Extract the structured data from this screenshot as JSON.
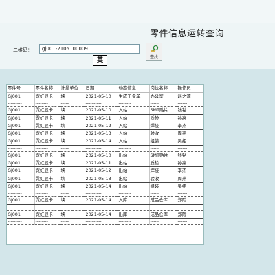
{
  "title": "零件信息运转查询",
  "qr_label": "二维码：",
  "qr_input": "gj001-2105100009",
  "ime_indicator": "英",
  "find_button": {
    "label": "查找",
    "icon": "search-icon"
  },
  "columns": [
    "零件号",
    "零件名称",
    "计量单位",
    "日期",
    "动态信息",
    "岗位名称",
    "操作员"
  ],
  "rows": [
    {
      "type": "data",
      "cells": [
        "Gj001",
        "霓虹显卡",
        "块",
        "2021-05-10",
        "生成工令单",
        "办公室",
        "赵之源"
      ]
    },
    {
      "type": "sep",
      "cells": [
        "---------",
        "--------",
        "-----",
        "----------",
        "--------",
        "------",
        "------"
      ]
    },
    {
      "type": "data",
      "cells": [
        "Gj001",
        "霓虹显卡",
        "块",
        "2021-05-10",
        "入站",
        "SMT贴片",
        "钱钻"
      ]
    },
    {
      "type": "data",
      "cells": [
        "Gj001",
        "霓虹显卡",
        "块",
        "2021-05-11",
        "入站",
        "质检",
        "孙高"
      ]
    },
    {
      "type": "data",
      "cells": [
        "Gj001",
        "霓虹显卡",
        "块",
        "2021-05-12",
        "入站",
        "焊接",
        "李杰"
      ]
    },
    {
      "type": "data",
      "cells": [
        "Gj001",
        "霓虹显卡",
        "块",
        "2021-05-13",
        "入站",
        "验收",
        "周燕"
      ]
    },
    {
      "type": "data",
      "cells": [
        "Gj001",
        "霓虹显卡",
        "块",
        "2021-05-14",
        "入站",
        "组装",
        "吴组"
      ]
    },
    {
      "type": "sep",
      "cells": [
        "---------",
        "--------",
        "-----",
        "----------",
        "--------",
        "------",
        "------"
      ]
    },
    {
      "type": "data",
      "cells": [
        "Gj001",
        "霓虹显卡",
        "块",
        "2021-05-10",
        "出站",
        "SMT贴片",
        "钱钻"
      ]
    },
    {
      "type": "data",
      "cells": [
        "Gj001",
        "霓虹显卡",
        "块",
        "2021-05-11",
        "出站",
        "质检",
        "孙高"
      ]
    },
    {
      "type": "data",
      "cells": [
        "Gj001",
        "霓虹显卡",
        "块",
        "2021-05-12",
        "出站",
        "焊接",
        "李杰"
      ]
    },
    {
      "type": "data",
      "cells": [
        "Gj001",
        "霓虹显卡",
        "块",
        "2021-05-13",
        "出站",
        "验收",
        "周燕"
      ]
    },
    {
      "type": "data",
      "cells": [
        "Gj001",
        "霓虹显卡",
        "块",
        "2021-05-14",
        "出站",
        "组装",
        "吴组"
      ]
    },
    {
      "type": "sep",
      "cells": [
        "---------",
        "--------",
        "-----",
        "----------",
        "--------",
        "------",
        "------"
      ]
    },
    {
      "type": "data",
      "cells": [
        "Gj001",
        "霓虹显卡",
        "块",
        "2021-05-14",
        "入库",
        "成品仓库",
        "郑险"
      ]
    },
    {
      "type": "sep",
      "cells": [
        "---------",
        "--------",
        "-----",
        "----------",
        "--------",
        "------",
        "------"
      ]
    },
    {
      "type": "data",
      "cells": [
        "Gj001",
        "霓虹显卡",
        "块",
        "2021-05-14",
        "出库",
        "成品仓库",
        "郑险"
      ]
    },
    {
      "type": "sep",
      "cells": [
        "---------",
        "--------",
        "-----",
        "----------",
        "--------",
        "------",
        "------"
      ]
    }
  ]
}
